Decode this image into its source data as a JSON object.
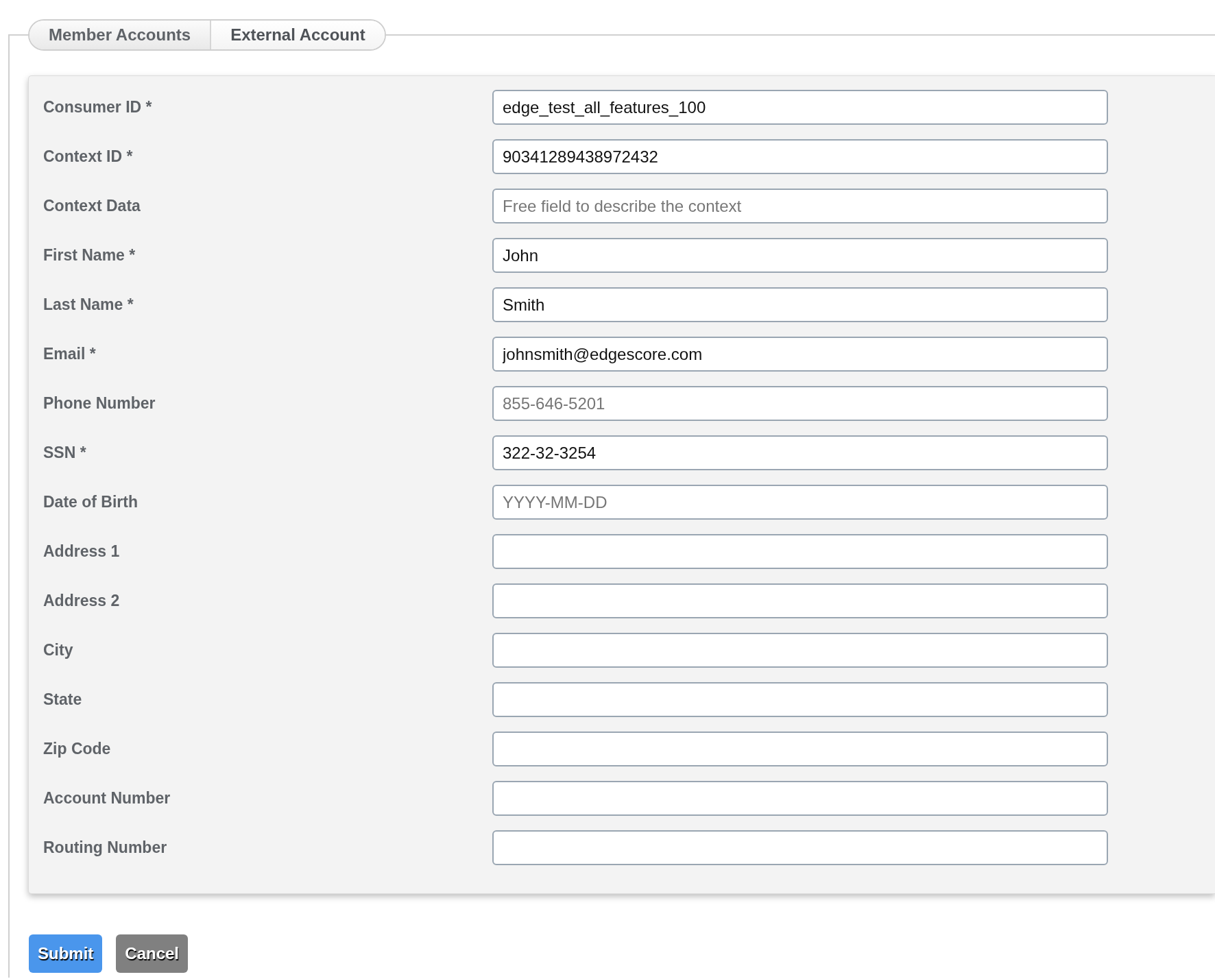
{
  "tabs": [
    {
      "label": "Member Accounts",
      "selected": false
    },
    {
      "label": "External Account",
      "selected": true
    }
  ],
  "fields": [
    {
      "label": "Consumer ID *",
      "value": "edge_test_all_features_100"
    },
    {
      "label": "Context ID *",
      "value": "90341289438972432"
    },
    {
      "label": "Context Data",
      "placeholder": "Free field to describe the context"
    },
    {
      "label": "First Name *",
      "value": "John"
    },
    {
      "label": "Last Name *",
      "value": "Smith"
    },
    {
      "label": "Email *",
      "value": "johnsmith@edgescore.com"
    },
    {
      "label": "Phone Number",
      "placeholder": "855-646-5201"
    },
    {
      "label": "SSN *",
      "value": "322-32-3254"
    },
    {
      "label": "Date of Birth",
      "placeholder": "YYYY-MM-DD"
    },
    {
      "label": "Address 1"
    },
    {
      "label": "Address 2"
    },
    {
      "label": "City"
    },
    {
      "label": "State"
    },
    {
      "label": "Zip Code"
    },
    {
      "label": "Account Number"
    },
    {
      "label": "Routing Number"
    }
  ],
  "buttons": [
    {
      "label": "Submit",
      "kind": "primary"
    },
    {
      "label": "Cancel",
      "kind": "secondary"
    }
  ]
}
